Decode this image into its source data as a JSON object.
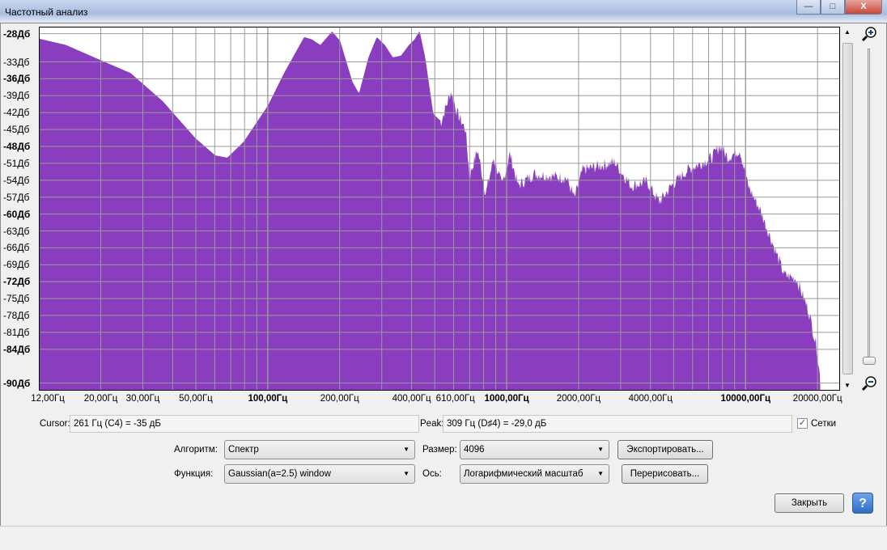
{
  "window": {
    "title": "Частотный анализ",
    "minimize": "—",
    "maximize": "□",
    "close": "X"
  },
  "y_labels": [
    {
      "t": "-28Дб",
      "v": -28,
      "b": true
    },
    {
      "t": "-33Дб",
      "v": -33
    },
    {
      "t": "-36Дб",
      "v": -36,
      "b": true
    },
    {
      "t": "-39Дб",
      "v": -39
    },
    {
      "t": "-42Дб",
      "v": -42
    },
    {
      "t": "-45Дб",
      "v": -45
    },
    {
      "t": "-48Дб",
      "v": -48,
      "b": true
    },
    {
      "t": "-51Дб",
      "v": -51
    },
    {
      "t": "-54Дб",
      "v": -54
    },
    {
      "t": "-57Дб",
      "v": -57
    },
    {
      "t": "-60Дб",
      "v": -60,
      "b": true
    },
    {
      "t": "-63Дб",
      "v": -63
    },
    {
      "t": "-66Дб",
      "v": -66
    },
    {
      "t": "-69Дб",
      "v": -69
    },
    {
      "t": "-72Дб",
      "v": -72,
      "b": true
    },
    {
      "t": "-75Дб",
      "v": -75
    },
    {
      "t": "-78Дб",
      "v": -78
    },
    {
      "t": "-81Дб",
      "v": -81
    },
    {
      "t": "-84Дб",
      "v": -84,
      "b": true
    },
    {
      "t": "-90Дб",
      "v": -90,
      "b": true
    }
  ],
  "x_labels": [
    {
      "t": "12,00Гц",
      "v": 12
    },
    {
      "t": "20,00Гц",
      "v": 20
    },
    {
      "t": "30,00Гц",
      "v": 30
    },
    {
      "t": "50,00Гц",
      "v": 50
    },
    {
      "t": "100,00Гц",
      "v": 100,
      "b": true
    },
    {
      "t": "200,00Гц",
      "v": 200
    },
    {
      "t": "400,00Гц",
      "v": 400
    },
    {
      "t": "610,00Гц",
      "v": 610
    },
    {
      "t": "1000,00Гц",
      "v": 1000,
      "b": true
    },
    {
      "t": "2000,00Гц",
      "v": 2000
    },
    {
      "t": "4000,00Гц",
      "v": 4000
    },
    {
      "t": "10000,00Гц",
      "v": 10000,
      "b": true
    },
    {
      "t": "20000,00Гц",
      "v": 20000
    }
  ],
  "chart_data": {
    "type": "area",
    "xscale": "log",
    "xlim": [
      11.1,
      24660
    ],
    "ylim": [
      -91.2,
      -26.9
    ],
    "grid": true,
    "color": "#8a3dbf",
    "x": [
      11.1,
      14.3,
      19.5,
      26.7,
      36.4,
      49.7,
      60.3,
      67.7,
      79.2,
      100,
      117,
      142,
      153,
      166,
      186,
      201,
      226,
      241,
      264,
      286,
      309,
      334,
      361,
      390,
      412,
      432,
      456,
      493,
      532,
      585,
      622,
      673,
      699,
      756,
      817,
      883,
      955,
      1032,
      1115,
      1303,
      1778,
      1923,
      2080,
      2838,
      3313,
      3872,
      4352,
      4890,
      5715,
      7216,
      7800,
      8433,
      9466,
      10240,
      11506,
      12922,
      14516,
      16315,
      18357,
      19830,
      20610
    ],
    "y": [
      -28.9,
      -30.0,
      -32.5,
      -35.0,
      -40.0,
      -46.5,
      -49.6,
      -50.0,
      -47.2,
      -40.8,
      -35.0,
      -28.6,
      -29.0,
      -30.0,
      -27.6,
      -29.3,
      -36.5,
      -38.6,
      -32.2,
      -28.6,
      -30.0,
      -32.2,
      -31.9,
      -30.0,
      -29.0,
      -27.5,
      -32.2,
      -42.2,
      -43.6,
      -38.2,
      -42.2,
      -45.0,
      -53.3,
      -48.6,
      -56.5,
      -50.0,
      -55.0,
      -49.3,
      -55.0,
      -52.9,
      -53.6,
      -57.2,
      -52.2,
      -50.8,
      -55.0,
      -54.3,
      -57.9,
      -55.0,
      -52.2,
      -50.0,
      -47.9,
      -50.0,
      -48.6,
      -55.0,
      -59.3,
      -65.0,
      -70.8,
      -71.5,
      -77.2,
      -83.6,
      -90.0
    ]
  },
  "cursor": {
    "label": "Cursor:",
    "value": "261 Гц (C4) = -35 дБ"
  },
  "peak": {
    "label": "Peak:",
    "value": "309 Гц (D♯4) = -29,0 дБ"
  },
  "grids": {
    "label": "Сетки",
    "checked": true
  },
  "algorithm": {
    "label": "Алгоритм:",
    "value": "Спектр"
  },
  "size": {
    "label": "Размер:",
    "value": "4096"
  },
  "function": {
    "label": "Функция:",
    "value": "Gaussian(a=2.5) window"
  },
  "axis": {
    "label": "Ось:",
    "value": "Логарифмический масштаб"
  },
  "buttons": {
    "export": "Экспортировать...",
    "replot": "Перерисовать...",
    "close": "Закрыть",
    "help": "?"
  }
}
